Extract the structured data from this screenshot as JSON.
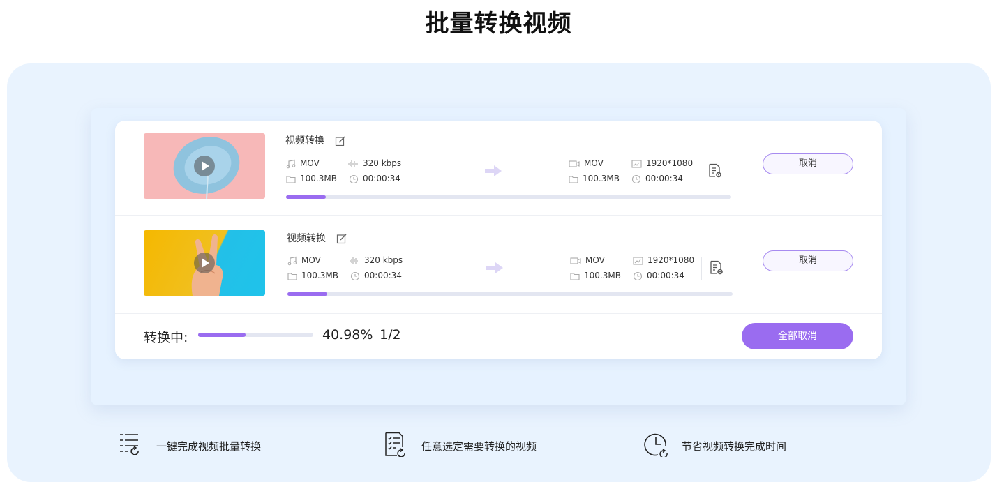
{
  "page": {
    "title": "批量转换视频"
  },
  "tasks": [
    {
      "name": "视频转换",
      "source": {
        "format": "MOV",
        "bitrate": "320 kbps",
        "size": "100.3MB",
        "duration": "00:00:34"
      },
      "target": {
        "format": "MOV",
        "resolution": "1920*1080",
        "size": "100.3MB",
        "duration": "00:00:34"
      },
      "progress": 0.09,
      "cancel_label": "取消",
      "thumbnail": "pink-plate-video"
    },
    {
      "name": "视频转换",
      "source": {
        "format": "MOV",
        "bitrate": "320 kbps",
        "size": "100.3MB",
        "duration": "00:00:34"
      },
      "target": {
        "format": "MOV",
        "resolution": "1920*1080",
        "size": "100.3MB",
        "duration": "00:00:34"
      },
      "progress": 0.09,
      "cancel_label": "取消",
      "thumbnail": "peace-hand-video"
    }
  ],
  "summary": {
    "label": "转换中:",
    "progress": 0.4098,
    "percent": "40.98%",
    "count": "1/2",
    "cancel_all_label": "全部取消"
  },
  "features": [
    {
      "icon": "list-refresh-icon",
      "text": "一键完成视频批量转换"
    },
    {
      "icon": "checklist-doc-icon",
      "text": "任意选定需要转换的视频"
    },
    {
      "icon": "clock-refresh-icon",
      "text": "节省视频转换完成时间"
    }
  ],
  "colors": {
    "accent": "#9a6cf0",
    "panel_bg": "#e9f3fe",
    "track": "#e3e6f1"
  }
}
